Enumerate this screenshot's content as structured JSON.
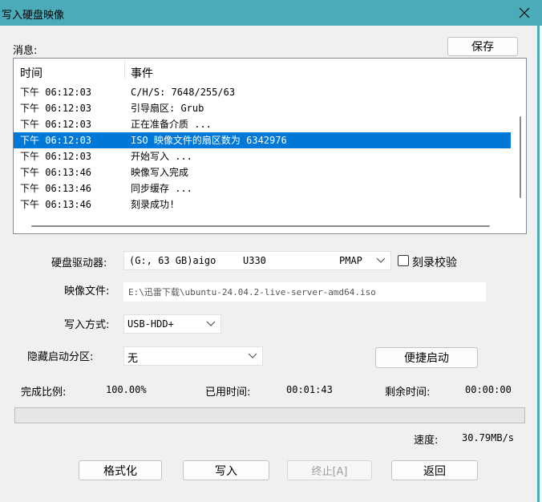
{
  "window": {
    "title": "写入硬盘映像",
    "close_icon": "close-icon"
  },
  "messages": {
    "label": "消息:",
    "save_label": "保存",
    "columns": [
      "时间",
      "事件"
    ],
    "rows": [
      {
        "time": "下午 06:12:03",
        "event": "C/H/S: 7648/255/63",
        "selected": false
      },
      {
        "time": "下午 06:12:03",
        "event": "引导扇区: Grub",
        "selected": false
      },
      {
        "time": "下午 06:12:03",
        "event": "正在准备介质 ...",
        "selected": false
      },
      {
        "time": "下午 06:12:03",
        "event": "ISO 映像文件的扇区数为 6342976",
        "selected": true
      },
      {
        "time": "下午 06:12:03",
        "event": "开始写入 ...",
        "selected": false
      },
      {
        "time": "下午 06:13:46",
        "event": "映像写入完成",
        "selected": false
      },
      {
        "time": "下午 06:13:46",
        "event": "同步缓存 ...",
        "selected": false
      },
      {
        "time": "下午 06:13:46",
        "event": "刻录成功!",
        "selected": false
      }
    ],
    "selection_color": "#0078d7"
  },
  "form": {
    "drive_label": "硬盘驱动器:",
    "drive_name": "(G:, 63 GB)aigo",
    "drive_model": "U330",
    "drive_tag": "PMAP",
    "verify_label": "刻录校验",
    "verify_checked": false,
    "image_label": "映像文件:",
    "image_value": "E:\\迅雷下载\\ubuntu-24.04.2-live-server-amd64.iso",
    "write_mode_label": "写入方式:",
    "write_mode_value": "USB-HDD+",
    "hidden_partition_label": "隐藏启动分区:",
    "hidden_partition_value": "无",
    "quick_boot_label": "便捷启动"
  },
  "status": {
    "complete_label": "完成比例:",
    "complete_value": "100.00%",
    "elapsed_label": "已用时间:",
    "elapsed_value": "00:01:43",
    "remaining_label": "剩余时间:",
    "remaining_value": "00:00:00",
    "progress_fraction": 0.0,
    "speed_label": "速度:",
    "speed_value": "30.79MB/s"
  },
  "buttons": {
    "format": "格式化",
    "write": "写入",
    "abort": "终止[A]",
    "back": "返回"
  }
}
